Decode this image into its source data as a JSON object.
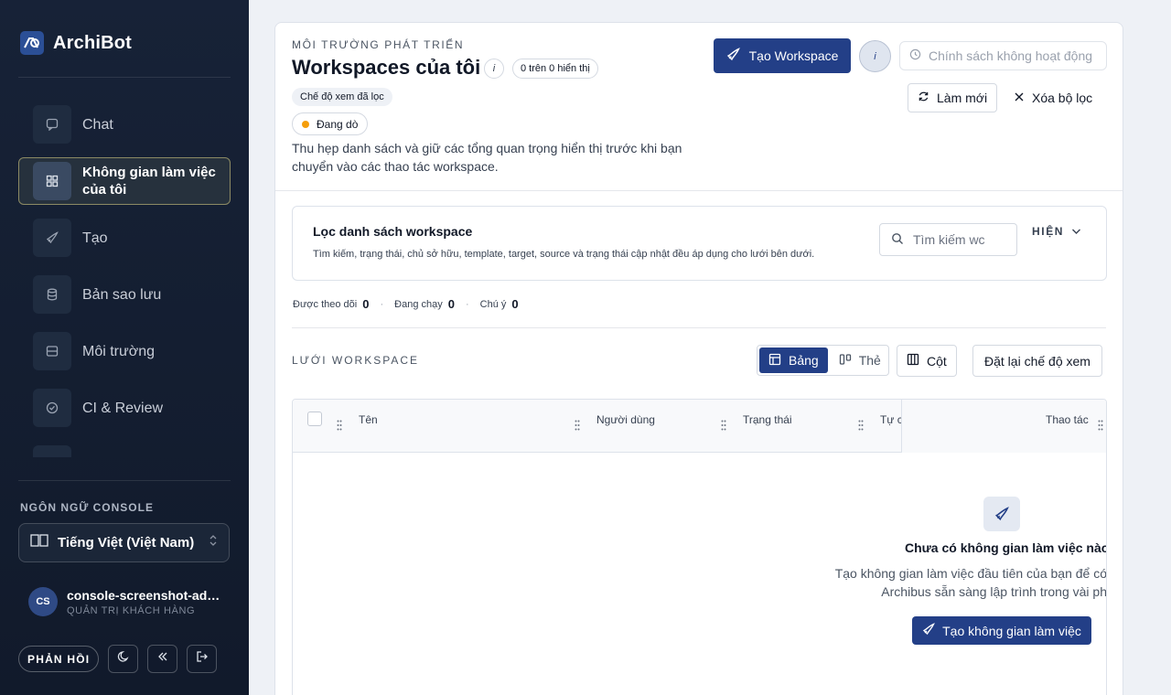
{
  "sidebar": {
    "brand": "ArchiBot",
    "nav": [
      {
        "label": "Chat",
        "icon": "chat-icon"
      },
      {
        "label": "Không gian làm việc của tôi",
        "icon": "grid-icon",
        "active": true
      },
      {
        "label": "Tạo",
        "icon": "rocket-icon"
      },
      {
        "label": "Bản sao lưu",
        "icon": "database-icon"
      },
      {
        "label": "Môi trường",
        "icon": "server-icon"
      },
      {
        "label": "CI & Review",
        "icon": "check-circle-icon"
      }
    ],
    "lang_title": "NGÔN NGỮ CONSOLE",
    "lang_value": "Tiếng Việt (Việt Nam)",
    "user": {
      "initials": "CS",
      "name": "console-screenshot-admin",
      "role": "QUẢN TRỊ KHÁCH HÀNG"
    },
    "feedback": "PHẢN HỒI"
  },
  "header": {
    "eyebrow": "MÔI TRƯỜNG PHÁT TRIỂN",
    "title": "Workspaces của tôi",
    "info": "i",
    "count_badge": "0 trên 0 hiển thị",
    "chip_filter": "Chế độ xem đã lọc",
    "chip_status": "Đang dò",
    "description": "Thu hẹp danh sách và giữ các tổng quan trọng hiển thị trước khi bạn chuyển vào các thao tác workspace.",
    "create_button": "Tạo Workspace",
    "policy_placeholder": "Chính sách không hoạt động",
    "refresh": "Làm mới",
    "clear_filter": "Xóa bộ lọc"
  },
  "filter": {
    "title": "Lọc danh sách workspace",
    "description": "Tìm kiếm, trạng thái, chủ sở hữu, template, target, source và trạng thái cập nhật đều áp dụng cho lưới bên dưới.",
    "search_placeholder": "Tìm kiếm wc",
    "toggle": "HIỆN"
  },
  "stats": [
    {
      "label": "Được theo dõi",
      "value": "0"
    },
    {
      "label": "Đang chạy",
      "value": "0"
    },
    {
      "label": "Chú ý",
      "value": "0"
    }
  ],
  "grid": {
    "title": "LƯỚI WORKSPACE",
    "view_table": "Bảng",
    "view_cards": "Thẻ",
    "columns_button": "Cột",
    "reset_view": "Đặt lại chế độ xem",
    "columns": [
      "Tên",
      "Người dùng",
      "Trạng thái",
      "Tự c",
      "Thao tác"
    ],
    "empty_title": "Chưa có không gian làm việc nào",
    "empty_line1": "Tạo không gian làm việc đầu tiên của bạn để có",
    "empty_line2": "Archibus sẵn sàng lập trình trong vài ph",
    "empty_cta": "Tạo không gian làm việc"
  },
  "colors": {
    "primary": "#233f87",
    "sidebar": "#172237",
    "status_dot": "#f59e0b"
  }
}
